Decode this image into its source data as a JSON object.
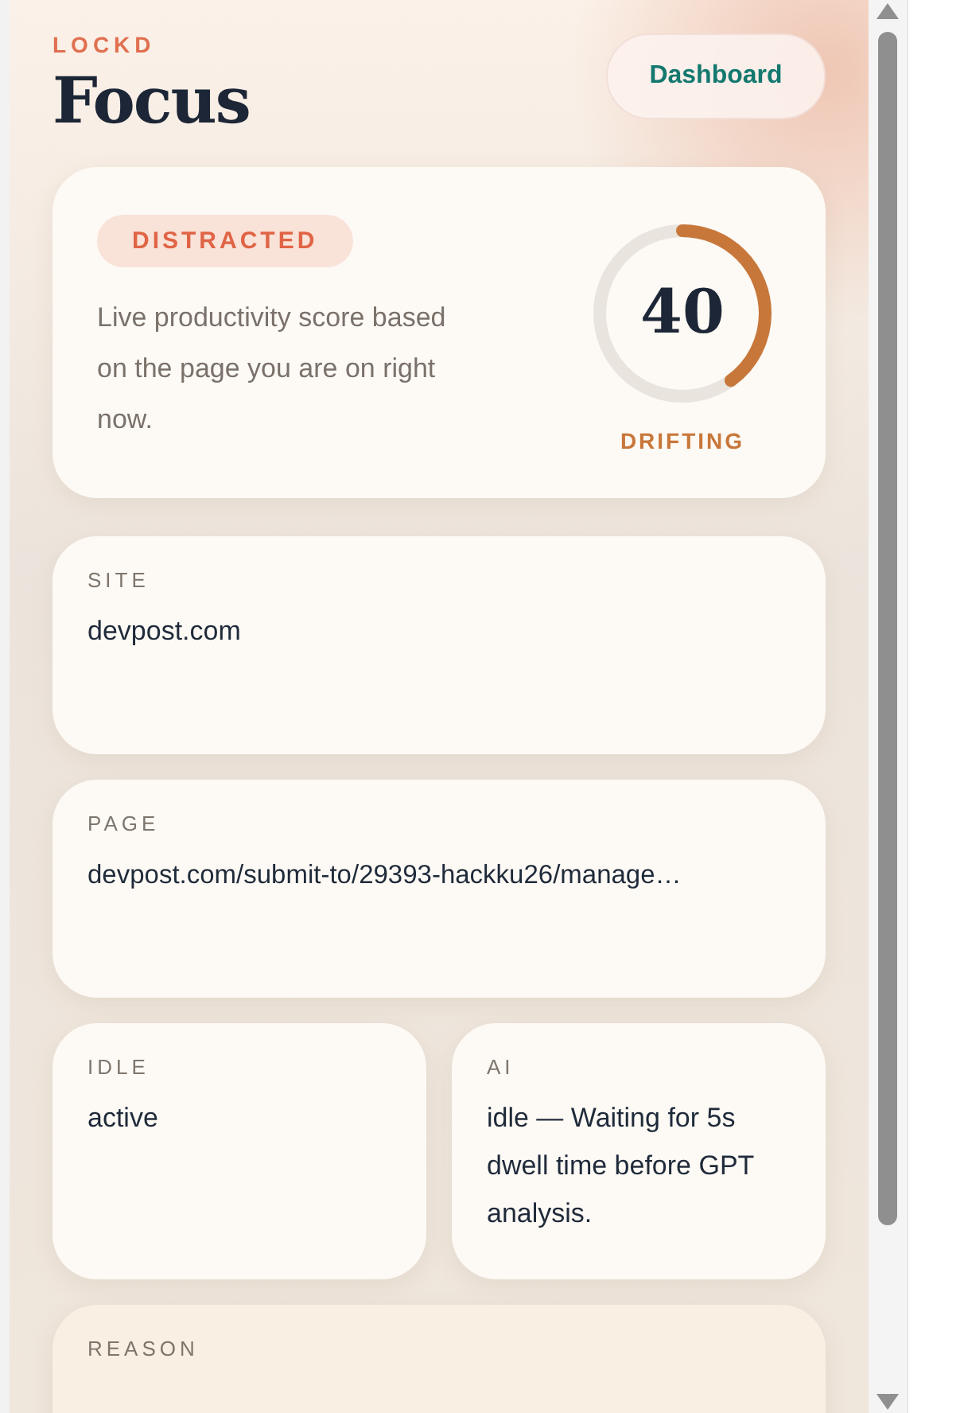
{
  "header": {
    "brand": "LOCKD",
    "title": "Focus",
    "button": "Dashboard"
  },
  "hero": {
    "badge": "DISTRACTED",
    "description": "Live productivity score based on the page you are on right now.",
    "score": "40",
    "level": 0.4,
    "score_label": "DRIFTING"
  },
  "cards": [
    {
      "label": "SITE",
      "value": "devpost.com",
      "kind": "wide"
    },
    {
      "label": "PAGE",
      "value": "devpost.com/submit-to/29393-hackku26/manage…",
      "kind": "wide"
    },
    {
      "label": "IDLE",
      "value": "active",
      "kind": "half"
    },
    {
      "label": "AI",
      "value": "idle — Waiting for 5s dwell time before GPT analysis.",
      "kind": "half"
    },
    {
      "label": "REASON",
      "kind": "wide"
    }
  ]
}
